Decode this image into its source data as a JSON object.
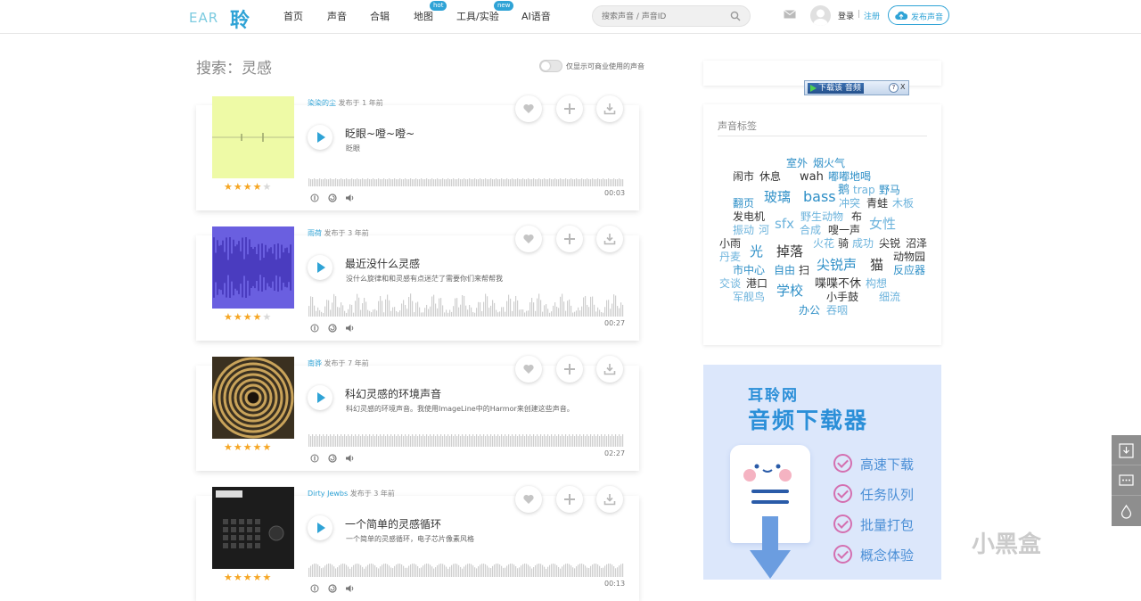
{
  "header": {
    "logo_en": "EAR",
    "logo_cn": "聆",
    "nav": [
      {
        "label": "首页"
      },
      {
        "label": "声音"
      },
      {
        "label": "合辑"
      },
      {
        "label": "地图",
        "badge": "hot"
      },
      {
        "label": "工具/实验",
        "badge": "new"
      },
      {
        "label": "AI语音"
      }
    ],
    "search_placeholder": "搜索声音 / 声音ID",
    "login": "登录",
    "separator": "|",
    "register": "注册",
    "publish": "发布声音"
  },
  "search": {
    "title": "搜索：灵感",
    "commercial_toggle_label": "仅显示可商业使用的声音",
    "commercial_toggle_on": false
  },
  "results": [
    {
      "author": "染染的尘",
      "published": "发布于 1 年前",
      "title": "眨眼~噔~噔~",
      "desc": "眨眼",
      "rating": 4,
      "duration": "00:03",
      "thumb_color": "#eefaa6"
    },
    {
      "author": "雨荷",
      "published": "发布于 3 年前",
      "title": "最近没什么灵感",
      "desc": "没什么旋律和和灵感有点迷茫了需要你们来帮帮我",
      "rating": 4,
      "duration": "00:27",
      "thumb_color": "#6a5fe0"
    },
    {
      "author": "南骅",
      "published": "发布于 7 年前",
      "title": "科幻灵感的环境声音",
      "desc": "科幻灵感的环境声音。我使用ImageLine中的Harmor来创建这些声音。",
      "rating": 5,
      "duration": "02:27",
      "thumb_color": "#3a3020"
    },
    {
      "author": "Dirty Jewbs",
      "published": "发布于 3 年前",
      "title": "一个简单的灵感循环",
      "desc": "一个简单的灵感循环，电子芯片像素风格",
      "rating": 5,
      "duration": "00:13",
      "thumb_color": "#1c1c1c"
    }
  ],
  "download_toolbar": {
    "label": "下载该 音频",
    "help": "?",
    "close": "X"
  },
  "tags": {
    "heading": "声音标签",
    "items": [
      {
        "text": "室外",
        "color": "#2e8fc7"
      },
      {
        "text": "烟火气",
        "color": "#2e8fc7"
      },
      {
        "text": "闹市",
        "color": "#333333"
      },
      {
        "text": "休息",
        "color": "#333333"
      },
      {
        "text": "wah",
        "color": "#333333"
      },
      {
        "text": "嘟嘟地喝",
        "color": "#2e8fc7"
      },
      {
        "text": "鹅",
        "color": "#2e8fc7"
      },
      {
        "text": "trap",
        "color": "#6cb3dc"
      },
      {
        "text": "野马",
        "color": "#2e8fc7"
      },
      {
        "text": "翻页",
        "color": "#2e8fc7"
      },
      {
        "text": "玻璃",
        "color": "#2e8fc7"
      },
      {
        "text": "bass",
        "color": "#2e8fc7"
      },
      {
        "text": "冲突",
        "color": "#6cb3dc"
      },
      {
        "text": "青蛙",
        "color": "#333333"
      },
      {
        "text": "木板",
        "color": "#6cb3dc"
      },
      {
        "text": "发电机",
        "color": "#333333"
      },
      {
        "text": "野生动物",
        "color": "#6cb3dc"
      },
      {
        "text": "布",
        "color": "#333333"
      },
      {
        "text": "振动",
        "color": "#6cb3dc"
      },
      {
        "text": "河",
        "color": "#6cb3dc"
      },
      {
        "text": "sfx",
        "color": "#6cb3dc"
      },
      {
        "text": "合成",
        "color": "#6cb3dc"
      },
      {
        "text": "嗖一声",
        "color": "#333333"
      },
      {
        "text": "女性",
        "color": "#6cb3dc"
      },
      {
        "text": "小雨",
        "color": "#333333"
      },
      {
        "text": "火花",
        "color": "#6cb3dc"
      },
      {
        "text": "骑",
        "color": "#333333"
      },
      {
        "text": "成功",
        "color": "#6cb3dc"
      },
      {
        "text": "尖锐",
        "color": "#333333"
      },
      {
        "text": "沼泽",
        "color": "#333333"
      },
      {
        "text": "丹麦",
        "color": "#6cb3dc"
      },
      {
        "text": "光",
        "color": "#2e8fc7"
      },
      {
        "text": "掉落",
        "color": "#333333"
      },
      {
        "text": "动物园",
        "color": "#333333"
      },
      {
        "text": "尖锐声",
        "color": "#2e8fc7"
      },
      {
        "text": "猫",
        "color": "#333333"
      },
      {
        "text": "市中心",
        "color": "#2e8fc7"
      },
      {
        "text": "自由",
        "color": "#2e8fc7"
      },
      {
        "text": "扫",
        "color": "#333333"
      },
      {
        "text": "反应器",
        "color": "#2e8fc7"
      },
      {
        "text": "交谈",
        "color": "#6cb3dc"
      },
      {
        "text": "港口",
        "color": "#333333"
      },
      {
        "text": "喋喋不休",
        "color": "#333333"
      },
      {
        "text": "构想",
        "color": "#6cb3dc"
      },
      {
        "text": "学校",
        "color": "#2e8fc7"
      },
      {
        "text": "小手鼓",
        "color": "#333333"
      },
      {
        "text": "军舰鸟",
        "color": "#6cb3dc"
      },
      {
        "text": "细流",
        "color": "#6cb3dc"
      },
      {
        "text": "办公",
        "color": "#2e8fc7"
      },
      {
        "text": "吞咽",
        "color": "#6cb3dc"
      }
    ]
  },
  "promo": {
    "line1": "耳聆网",
    "line2": "音频下载器",
    "features": [
      "高速下载",
      "任务队列",
      "批量打包",
      "概念体验"
    ]
  },
  "watermark": "小黑盒"
}
